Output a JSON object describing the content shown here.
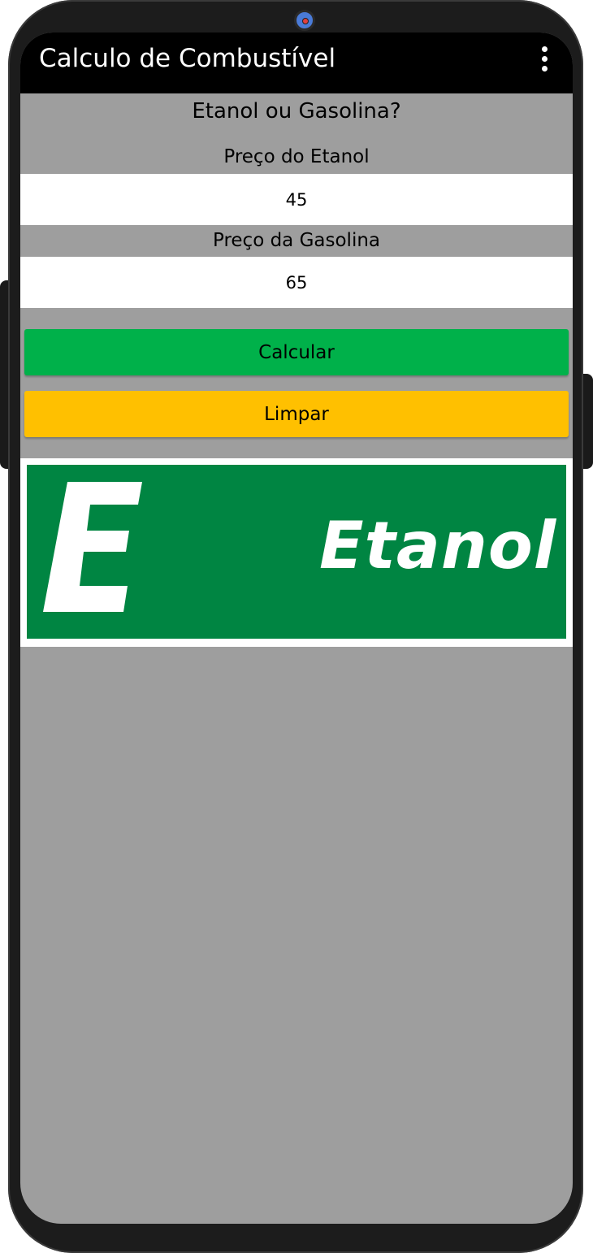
{
  "app": {
    "title": "Calculo de Combustível",
    "menu_icon": "more-vert-icon"
  },
  "form": {
    "question": "Etanol ou Gasolina?",
    "etanol_label": "Preço do Etanol",
    "etanol_value": "45",
    "gasolina_label": "Preço da Gasolina",
    "gasolina_value": "65",
    "calc_button": "Calcular",
    "clear_button": "Limpar"
  },
  "result": {
    "logo_letter": "E",
    "logo_word": "Etanol",
    "logo_color": "#008542"
  },
  "colors": {
    "background": "#9e9e9e",
    "appbar": "#000000",
    "calc_button": "#00b14a",
    "clear_button": "#ffc000"
  }
}
